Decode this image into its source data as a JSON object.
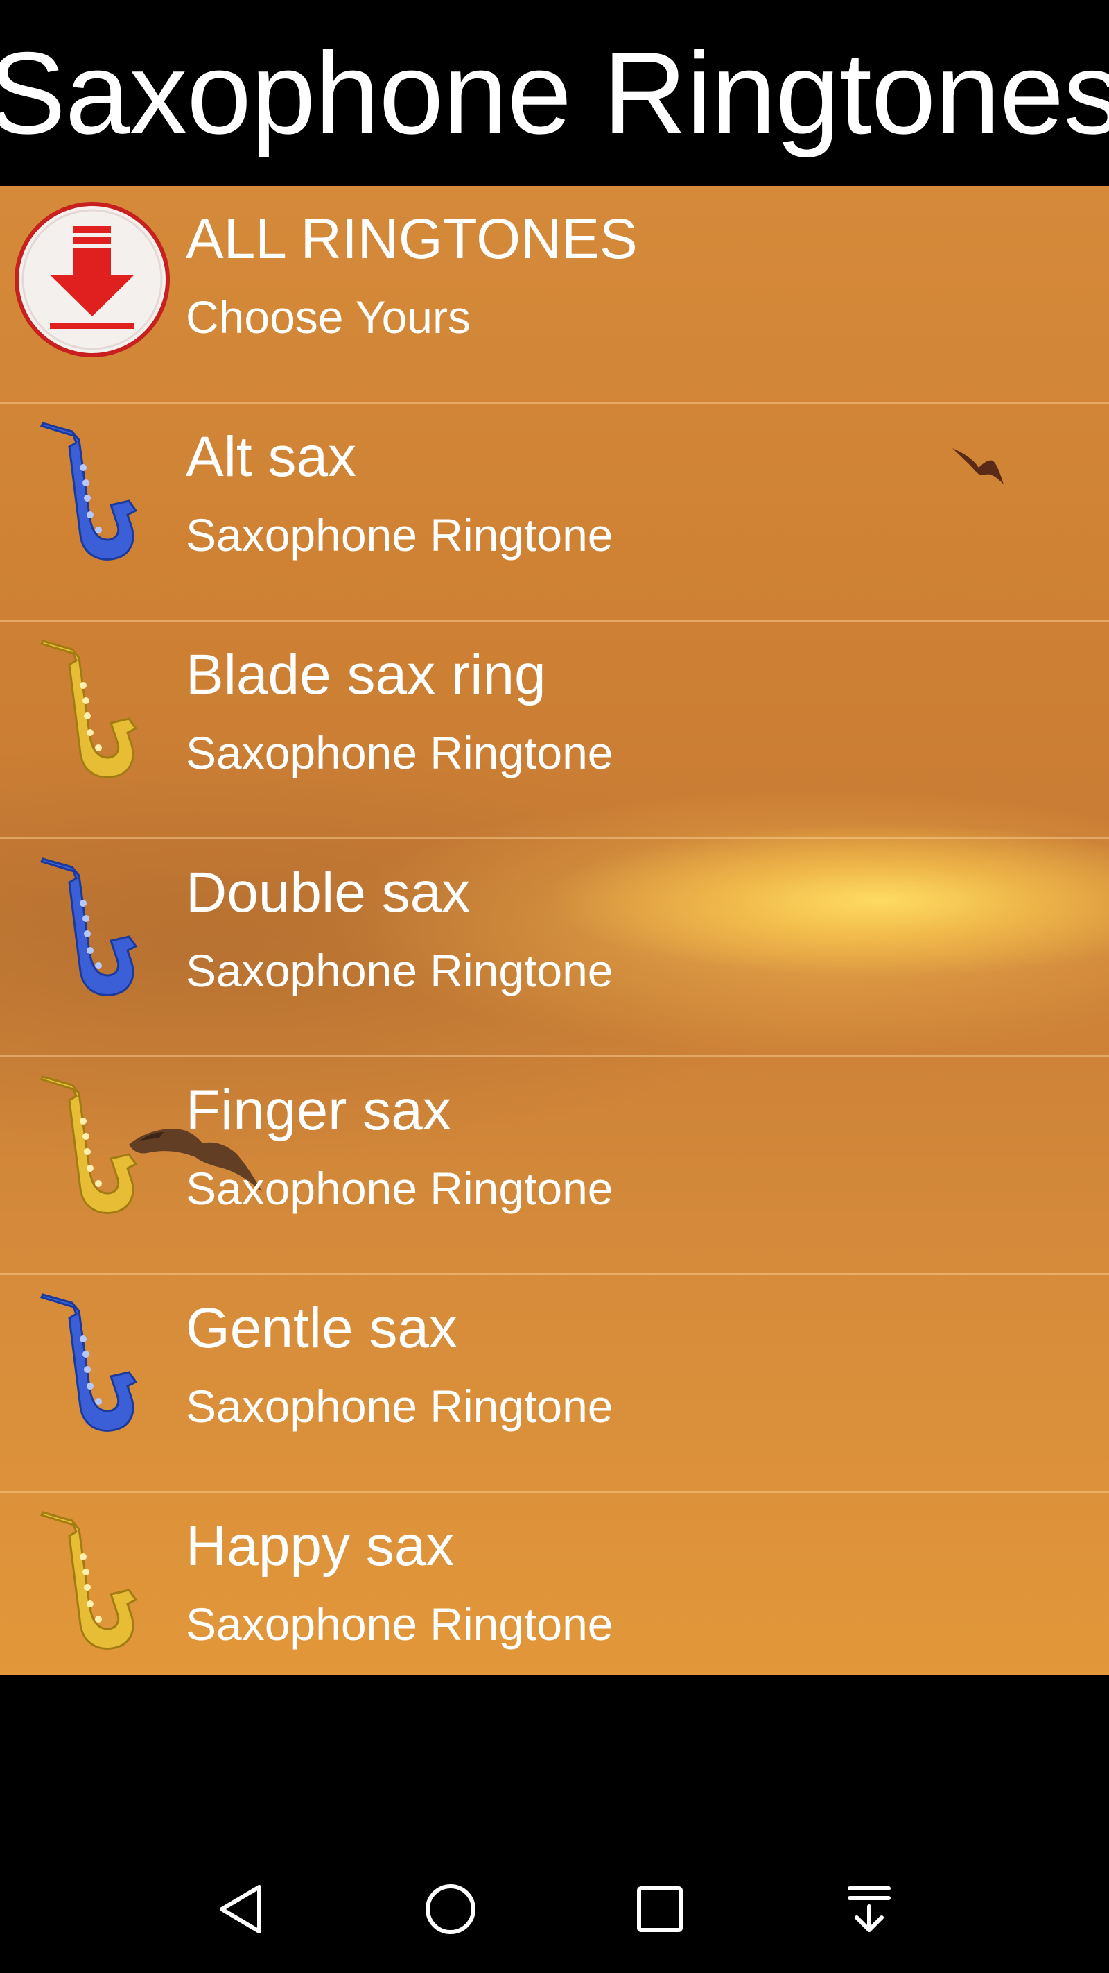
{
  "app": {
    "title": "Saxophone Ringtones"
  },
  "colors": {
    "title_bar_bg": "#000000",
    "list_bg_accent": "#d58a3a",
    "text": "#ffffff",
    "sax_blue": "#3a5fd6",
    "sax_gold": "#e0b830",
    "download_red": "#e02020"
  },
  "list": {
    "items": [
      {
        "title": "ALL RINGTONES",
        "subtitle": "Choose Yours",
        "icon": "download-icon"
      },
      {
        "title": "Alt sax",
        "subtitle": "Saxophone Ringtone",
        "icon": "blue-saxophone-icon"
      },
      {
        "title": "Blade sax ring",
        "subtitle": "Saxophone Ringtone",
        "icon": "gold-saxophone-icon"
      },
      {
        "title": "Double sax",
        "subtitle": "Saxophone Ringtone",
        "icon": "blue-saxophone-icon"
      },
      {
        "title": "Finger sax",
        "subtitle": "Saxophone Ringtone",
        "icon": "gold-saxophone-icon"
      },
      {
        "title": "Gentle sax",
        "subtitle": "Saxophone Ringtone",
        "icon": "blue-saxophone-icon"
      },
      {
        "title": "Happy sax",
        "subtitle": "Saxophone Ringtone",
        "icon": "gold-saxophone-icon"
      }
    ]
  },
  "nav": {
    "buttons": [
      "back-icon",
      "home-icon",
      "recents-icon",
      "notification-pull-icon"
    ]
  }
}
